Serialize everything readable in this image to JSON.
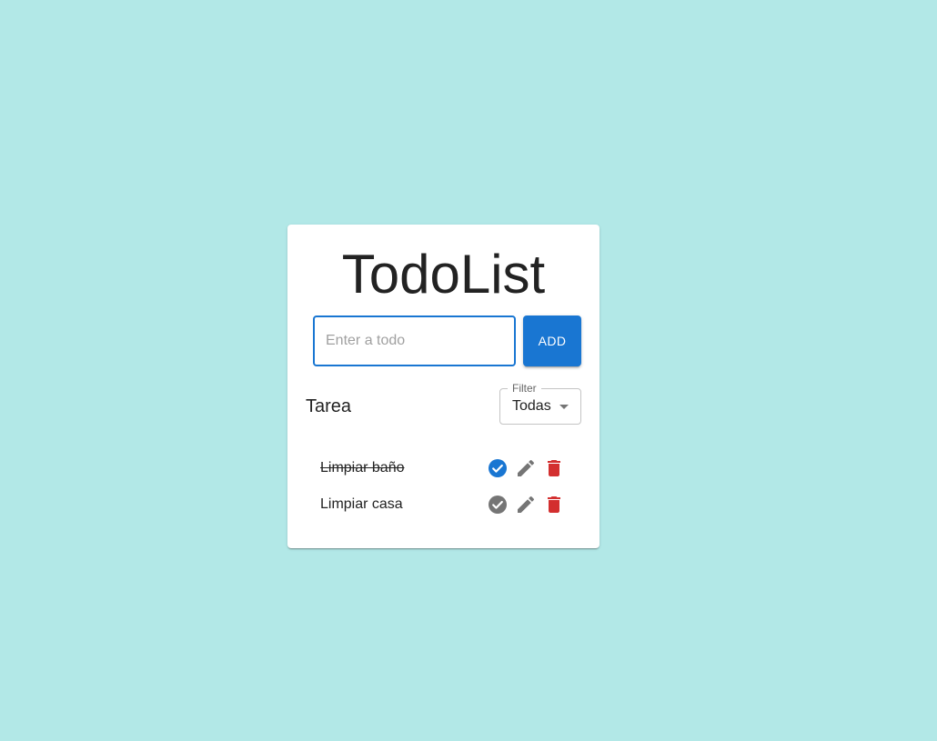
{
  "app": {
    "title": "TodoList"
  },
  "input": {
    "placeholder": "Enter a todo",
    "value": ""
  },
  "add_button": {
    "label": "ADD"
  },
  "section": {
    "label": "Tarea"
  },
  "filter": {
    "legend": "Filter",
    "selected": "Todas"
  },
  "todos": [
    {
      "text": "Limpiar baño",
      "completed": true
    },
    {
      "text": "Limpiar casa",
      "completed": false
    }
  ],
  "colors": {
    "background": "#b2e8e7",
    "primary": "#1976d2",
    "icon_gray": "#757575",
    "danger": "#d32f2f"
  },
  "icons": {
    "complete": "check-circle-icon",
    "edit": "pencil-icon",
    "delete": "trash-icon"
  }
}
